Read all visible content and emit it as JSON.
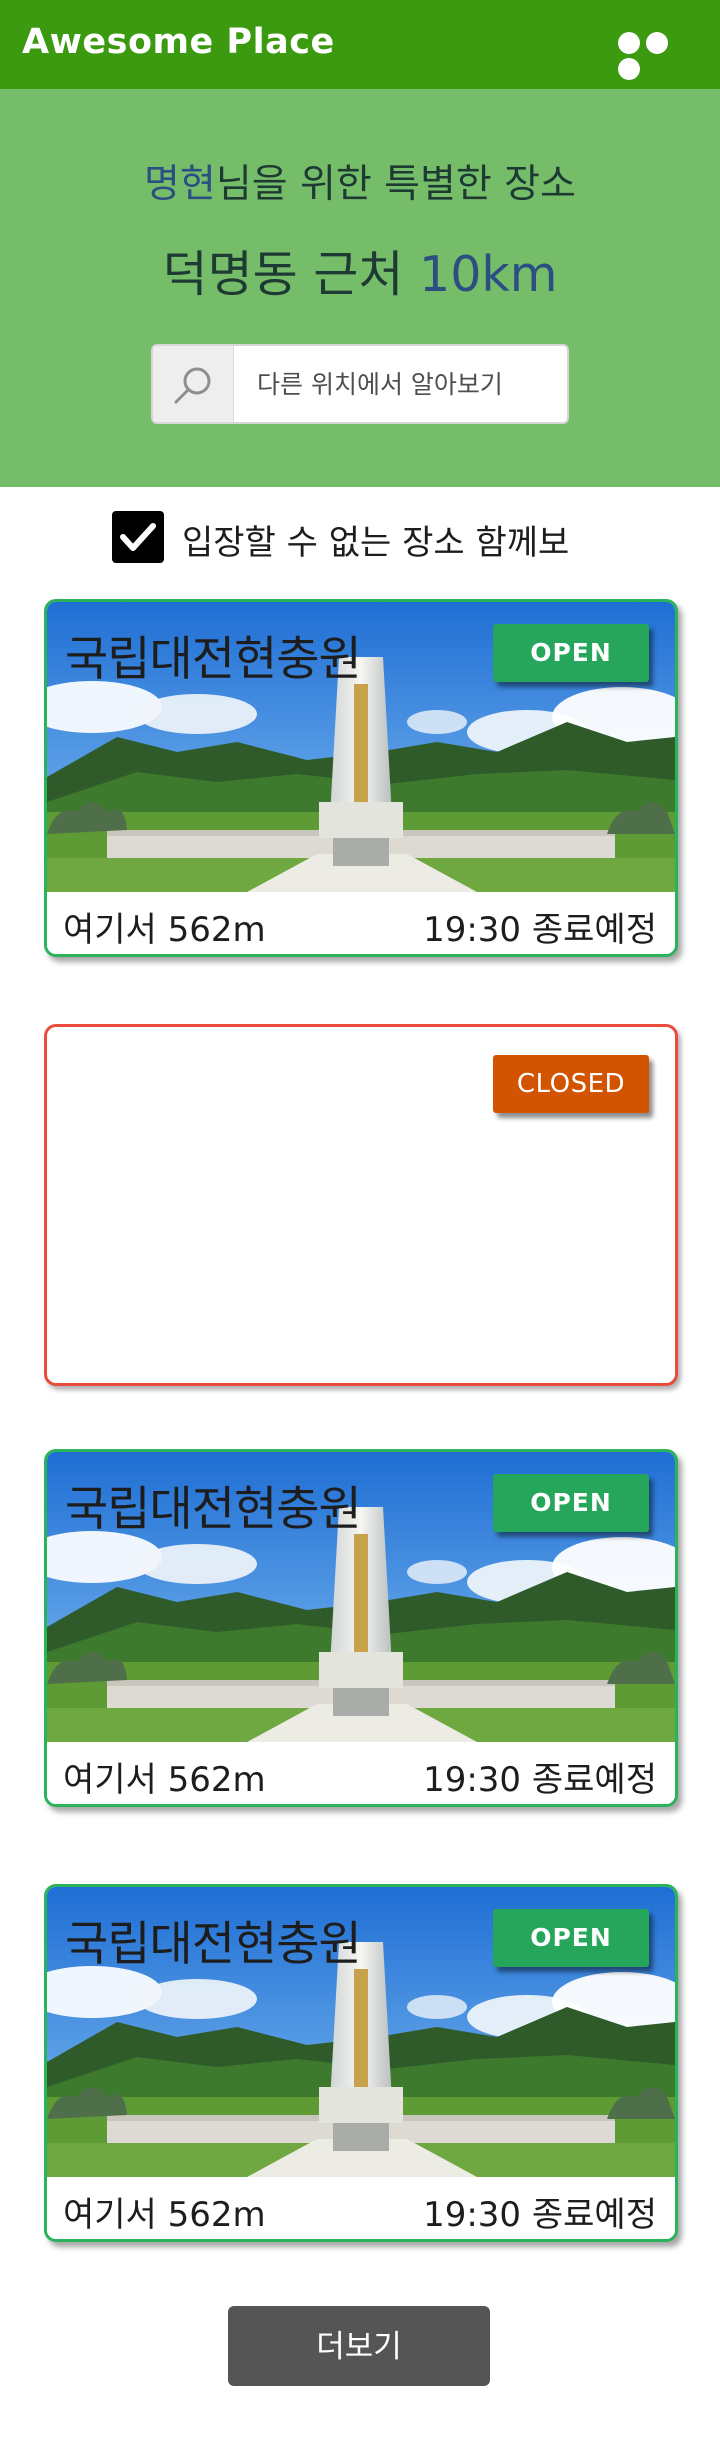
{
  "app": {
    "title": "Awesome Place",
    "menu_icon": "more-dots-icon"
  },
  "hero": {
    "user_name": "명현",
    "subtitle_suffix": "님을 위한 특별한 장소",
    "location": "덕명동 근처",
    "distance": "10km"
  },
  "search": {
    "placeholder": "다른 위치에서 알아보기",
    "icon": "search-icon"
  },
  "filter": {
    "label": "입장할 수 없는 장소 함께보",
    "checked": true
  },
  "places": [
    {
      "name": "국립대전현충원",
      "status": "OPEN",
      "distance": "여기서 562m",
      "closing": "19:30 종료예정"
    },
    {
      "name": "",
      "status": "CLOSED",
      "distance": "",
      "closing": ""
    },
    {
      "name": "국립대전현충원",
      "status": "OPEN",
      "distance": "여기서 562m",
      "closing": "19:30 종료예정"
    },
    {
      "name": "국립대전현충원",
      "status": "OPEN",
      "distance": "여기서 562m",
      "closing": "19:30 종료예정"
    }
  ],
  "more_button": {
    "label": "더보기"
  },
  "colors": {
    "topbar": "#3b9a10",
    "hero": "#76bd6a",
    "open_badge": "#25a65a",
    "closed_badge": "#d35400",
    "open_border": "#2bb35b",
    "closed_border": "#e94b3c",
    "more_button": "#555555"
  }
}
